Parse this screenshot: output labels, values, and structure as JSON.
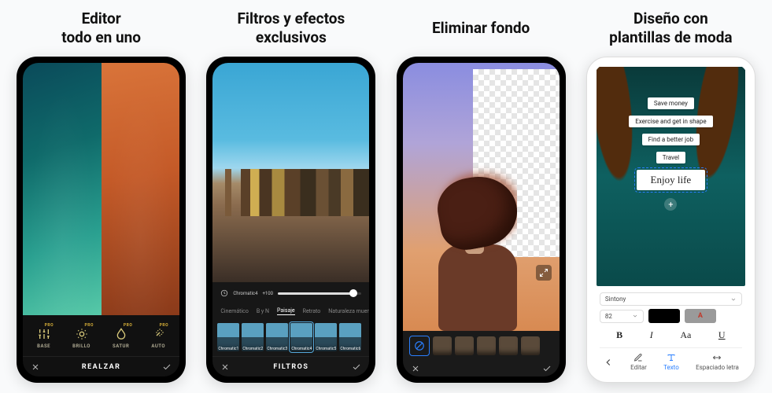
{
  "cards": [
    {
      "title": "Editor\ntodo en uno"
    },
    {
      "title": "Filtros y efectos\nexclusivos"
    },
    {
      "title": "Eliminar fondo"
    },
    {
      "title": "Diseño con\nplantillas de moda"
    }
  ],
  "phone1": {
    "pro_badge": "PRO",
    "tools": [
      "BASE",
      "BRILLO",
      "SATUR",
      "AUTO"
    ],
    "footer_label": "REALZAR"
  },
  "phone2": {
    "slider_label": "Chromatic4",
    "slider_value": "+100",
    "categories": [
      "Cinemático",
      "B y N",
      "Paisaje",
      "Retrato",
      "Naturaleza muert"
    ],
    "active_category_index": 2,
    "thumbs": [
      "Chromatic1",
      "Chromatic2",
      "Chromatic3",
      "Chromatic4",
      "Chromatic5",
      "Chromatic6"
    ],
    "selected_thumb_index": 3,
    "footer_label": "FILTROS"
  },
  "phone3": {
    "thumbs_count": 6
  },
  "phone4": {
    "chips": [
      "Save money",
      "Exercise and get in shape",
      "Find a better job",
      "Travel"
    ],
    "big_chip": "Enjoy life",
    "font_select": "Sintony",
    "size_select": "82",
    "swatch_letter": "A",
    "format_btns": [
      "B",
      "I",
      "Aa",
      "U"
    ],
    "footer": {
      "edit": "Editar",
      "text": "Texto",
      "spacing": "Espaciado letra"
    }
  }
}
